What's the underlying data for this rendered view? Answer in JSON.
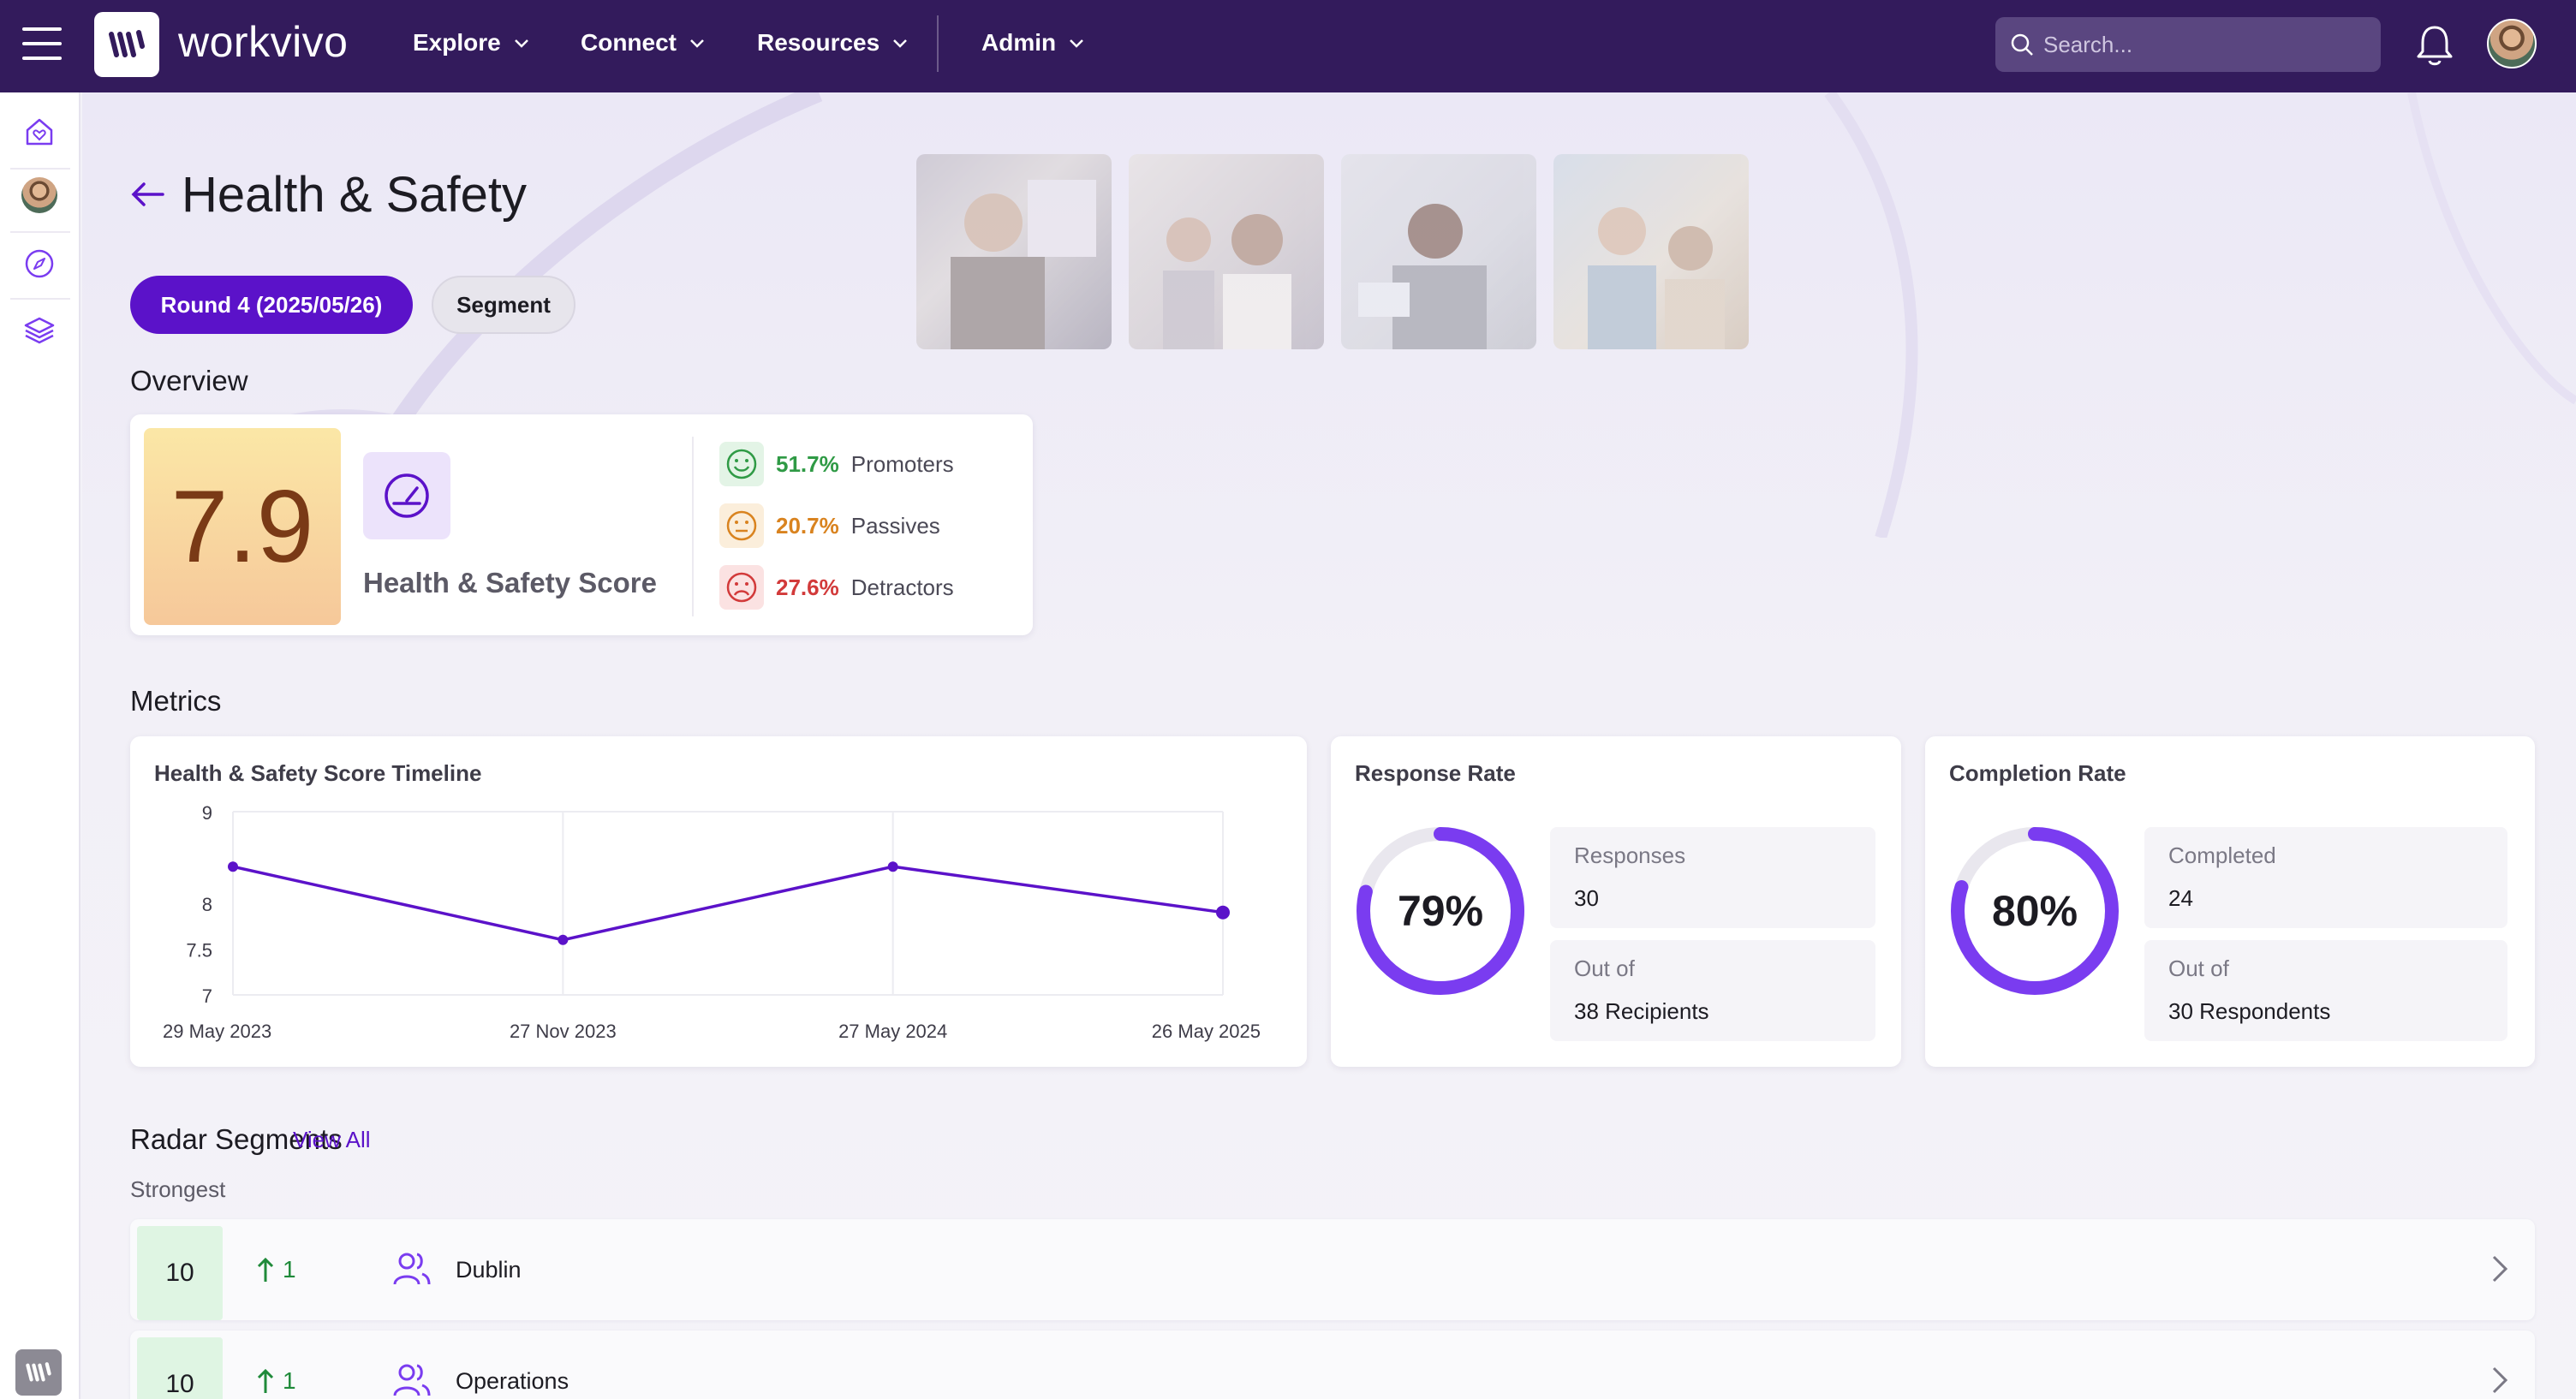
{
  "app": {
    "brand": "workvivo",
    "nav": [
      {
        "label": "Explore"
      },
      {
        "label": "Connect"
      },
      {
        "label": "Resources"
      },
      {
        "label": "Admin"
      }
    ],
    "search_placeholder": "Search..."
  },
  "page": {
    "title": "Health & Safety",
    "round_label": "Round 4 (2025/05/26)",
    "segment_label": "Segment"
  },
  "overview": {
    "section_title": "Overview",
    "score": "7.9",
    "score_label": "Health & Safety Score",
    "promoters_pct": "51.7%",
    "promoters_label": "Promoters",
    "passives_pct": "20.7%",
    "passives_label": "Passives",
    "detractors_pct": "27.6%",
    "detractors_label": "Detractors"
  },
  "metrics": {
    "section_title": "Metrics",
    "timeline_title": "Health & Safety Score Timeline",
    "response": {
      "title": "Response Rate",
      "pct_label": "79%",
      "pct": 79,
      "responses_label": "Responses",
      "responses_value": "30",
      "outof_label": "Out of",
      "outof_value": "38 Recipients"
    },
    "completion": {
      "title": "Completion Rate",
      "pct_label": "80%",
      "pct": 80,
      "completed_label": "Completed",
      "completed_value": "24",
      "outof_label": "Out of",
      "outof_value": "30 Respondents"
    }
  },
  "chart_data": {
    "type": "line",
    "title": "Health & Safety Score Timeline",
    "x": [
      "29 May 2023",
      "27 Nov 2023",
      "27 May 2024",
      "26 May 2025"
    ],
    "x_tick_labels": [
      "29 May 2023",
      "27 Nov 2023",
      "27 May 2024",
      "26 May 2025"
    ],
    "y_tick_labels": [
      "9",
      "8",
      "7.5",
      "7"
    ],
    "series": [
      {
        "values": [
          8.4,
          7.6,
          8.4,
          7.9
        ]
      }
    ],
    "ylim": [
      7,
      9
    ],
    "grid": true,
    "color": "#5b12c9"
  },
  "radar": {
    "section_title": "Radar Segments",
    "view_all": "View All",
    "strongest_label": "Strongest",
    "rows": [
      {
        "score": "10",
        "change": "1",
        "name": "Dublin"
      },
      {
        "score": "10",
        "change": "1",
        "name": "Operations"
      }
    ]
  },
  "colors": {
    "topbar": "#331b5c",
    "accent": "#5b12c9",
    "promoters": "#2f9a45",
    "passives": "#d9831f",
    "detractors": "#d23a3a",
    "ring": "#7a3cf0",
    "score_text": "#7a3a16"
  }
}
